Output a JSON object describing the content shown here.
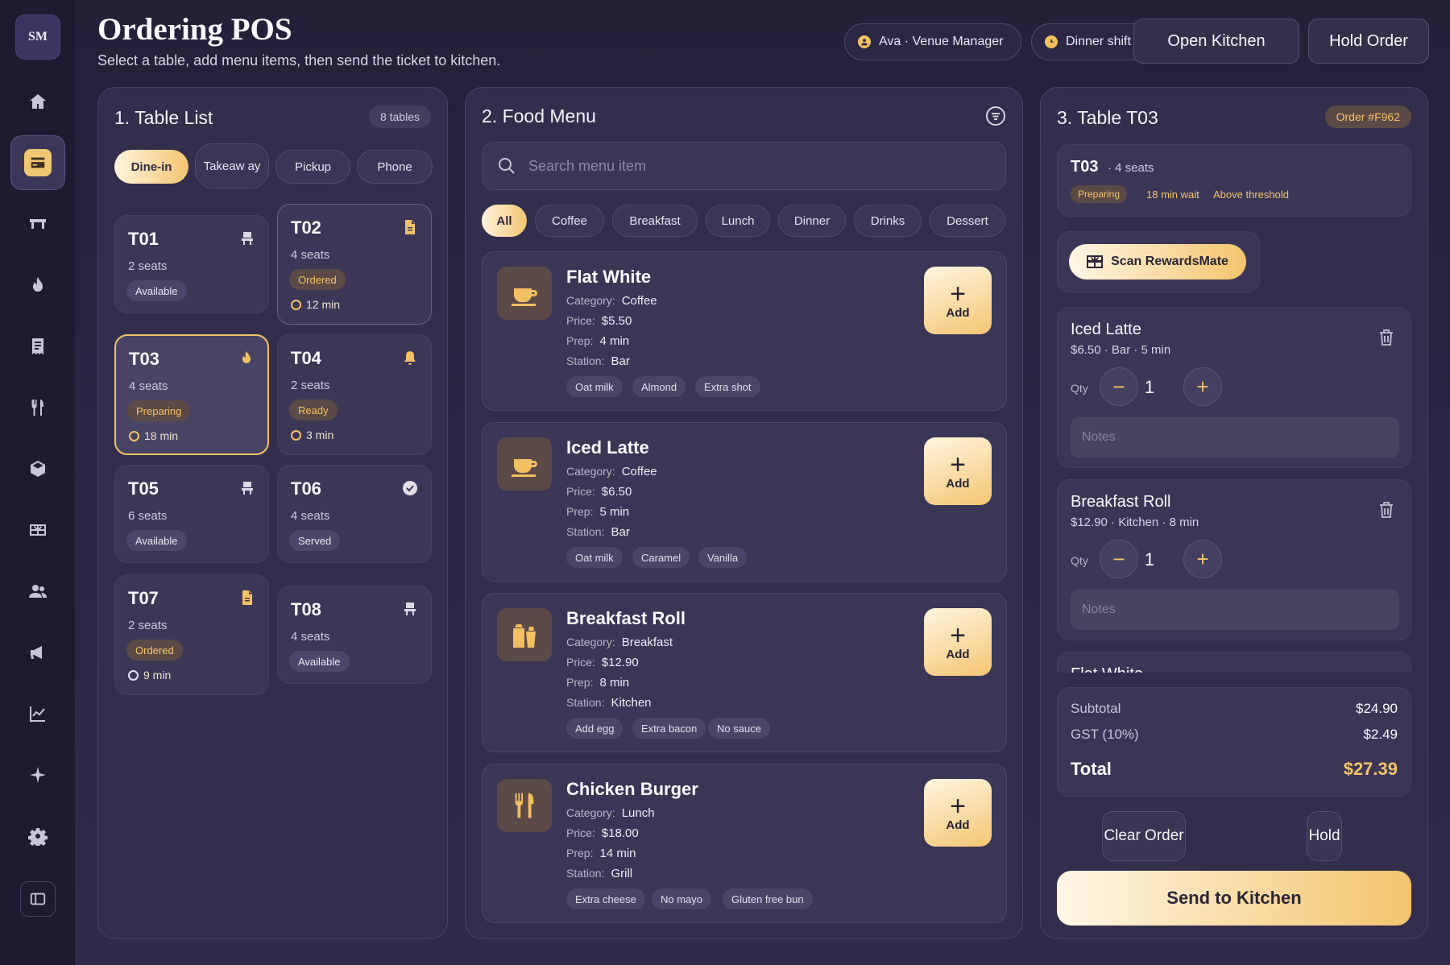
{
  "brand": {
    "initials": "SM"
  },
  "header": {
    "title": "Ordering POS",
    "subtitle": "Select a table, add menu items, then send the ticket to kitchen.",
    "user": "Ava · Venue Manager",
    "shift": "Dinner shift",
    "open_kitchen": "Open Kitchen",
    "hold_order": "Hold Order"
  },
  "tables": {
    "title": "1. Table List",
    "count": "8 tables",
    "modes": [
      "Dine-in",
      "Takeaw ay",
      "Pickup",
      "Phone"
    ],
    "items": [
      {
        "name": "T01",
        "seats": "2 seats",
        "status": "Available",
        "time": "",
        "icon": "chair-icon"
      },
      {
        "name": "T02",
        "seats": "4 seats",
        "status": "Ordered",
        "time": "12 min",
        "icon": "document-icon"
      },
      {
        "name": "T03",
        "seats": "4 seats",
        "status": "Preparing",
        "time": "18 min",
        "icon": "flame-icon"
      },
      {
        "name": "T04",
        "seats": "2 seats",
        "status": "Ready",
        "time": "3 min",
        "icon": "bell-icon"
      },
      {
        "name": "T05",
        "seats": "6 seats",
        "status": "Available",
        "time": "",
        "icon": "chair-icon"
      },
      {
        "name": "T06",
        "seats": "4 seats",
        "status": "Served",
        "time": "",
        "icon": "check-circle-icon"
      },
      {
        "name": "T07",
        "seats": "2 seats",
        "status": "Ordered",
        "time": "9 min",
        "icon": "document-icon"
      },
      {
        "name": "T08",
        "seats": "4 seats",
        "status": "Available",
        "time": "",
        "icon": "chair-icon"
      }
    ]
  },
  "menu": {
    "title": "2. Food Menu",
    "search_placeholder": "Search menu item",
    "filters": [
      "All",
      "Coffee",
      "Breakfast",
      "Lunch",
      "Dinner",
      "Drinks",
      "Dessert"
    ],
    "labels": {
      "category": "Category:",
      "price": "Price:",
      "prep": "Prep:",
      "station": "Station:",
      "add": "Add"
    },
    "items": [
      {
        "name": "Flat White",
        "category": "Coffee",
        "price": "$5.50",
        "prep": "4 min",
        "station": "Bar",
        "tags": [
          "Oat milk",
          "Almond",
          "Extra shot"
        ],
        "icon": "coffee-cup-icon"
      },
      {
        "name": "Iced Latte",
        "category": "Coffee",
        "price": "$6.50",
        "prep": "5 min",
        "station": "Bar",
        "tags": [
          "Oat milk",
          "Caramel",
          "Vanilla"
        ],
        "icon": "coffee-cup-icon"
      },
      {
        "name": "Breakfast Roll",
        "category": "Breakfast",
        "price": "$12.90",
        "prep": "8 min",
        "station": "Kitchen",
        "tags": [
          "Add egg",
          "Extra bacon",
          "No sauce"
        ],
        "icon": "takeaway-bag-icon"
      },
      {
        "name": "Chicken Burger",
        "category": "Lunch",
        "price": "$18.00",
        "prep": "14 min",
        "station": "Grill",
        "tags": [
          "Extra cheese",
          "No mayo",
          "Gluten free bun"
        ],
        "icon": "fork-knife-icon"
      }
    ]
  },
  "order": {
    "title": "3. Table T03",
    "number": "Order #F962",
    "table": "T03",
    "seats": "· 4 seats",
    "status": "Preparing",
    "wait": "18 min wait",
    "alert": "Above threshold",
    "scan": "Scan RewardsMate",
    "qty_label": "Qty",
    "notes_placeholder": "Notes",
    "lines": [
      {
        "name": "Iced Latte",
        "meta": "$6.50 · Bar · 5 min",
        "qty": "1"
      },
      {
        "name": "Breakfast Roll",
        "meta": "$12.90 · Kitchen · 8 min",
        "qty": "1"
      },
      {
        "name": "Flat White"
      }
    ],
    "subtotal_label": "Subtotal",
    "subtotal": "$24.90",
    "gst_label": "GST (10%)",
    "gst": "$2.49",
    "total_label": "Total",
    "total": "$27.39",
    "clear": "Clear Order",
    "hold": "Hold",
    "send": "Send to Kitchen"
  },
  "colors": {
    "accent": "#f3c46c",
    "panel": "#332e4c",
    "card": "#3b3656",
    "background": "#2a2542"
  }
}
